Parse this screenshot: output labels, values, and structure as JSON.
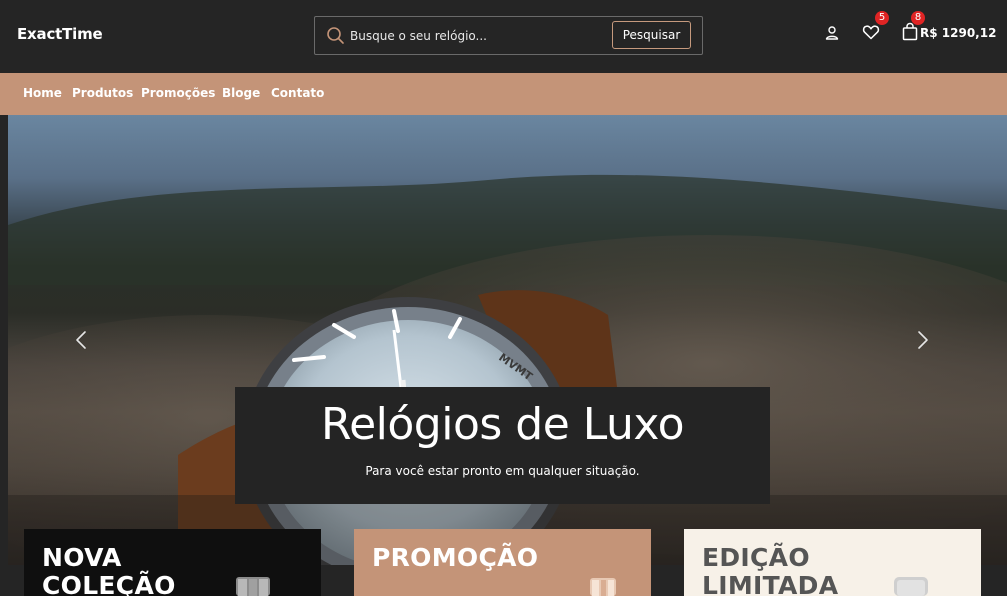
{
  "header": {
    "logo": "ExactTime",
    "search": {
      "placeholder": "Busque o seu relógio...",
      "button_label": "Pesquisar"
    },
    "wishlist_count": "5",
    "cart_count": "8",
    "cart_total": "R$ 1290,12"
  },
  "nav": {
    "items": [
      {
        "label": "Home"
      },
      {
        "label": "Produtos"
      },
      {
        "label": "Promoções"
      },
      {
        "label": "Bloge"
      },
      {
        "label": "Contato"
      }
    ]
  },
  "hero": {
    "title": "Relógios de Luxo",
    "subtitle": "Para você estar pronto em qualquer situação.",
    "watch_brand": "MVMT"
  },
  "categories": [
    {
      "title_line1": "NOVA",
      "title_line2": "COLEÇÃO"
    },
    {
      "title_line1": "PROMOÇÃO",
      "title_line2": ""
    },
    {
      "title_line1": "EDIÇÃO",
      "title_line2": "LIMITADA"
    }
  ],
  "colors": {
    "accent": "#c49478",
    "header_bg": "#252525",
    "badge": "#e02424",
    "card_light": "#f7f1e8"
  }
}
